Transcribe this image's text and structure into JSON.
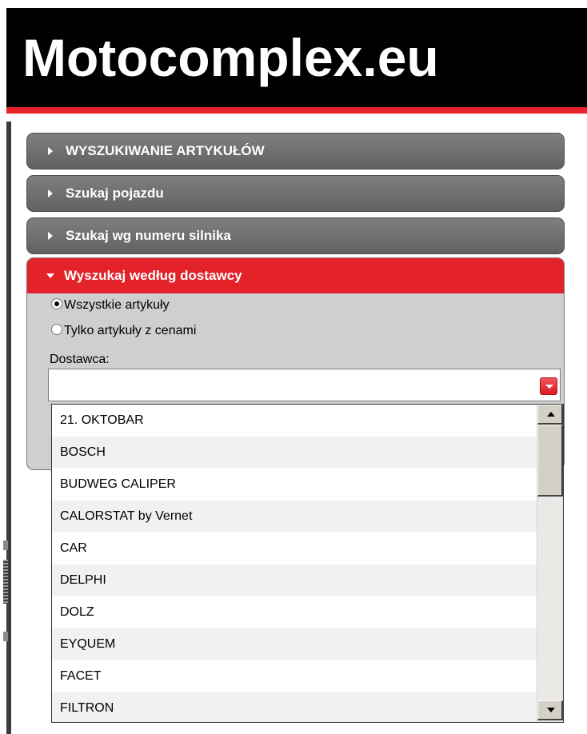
{
  "header": {
    "logo_text": "Motocomplex.eu"
  },
  "colors": {
    "brand_red": "#e3222a",
    "panel_gray": "#6e6e6e",
    "header_black": "#000000"
  },
  "accordion": {
    "items": [
      {
        "label": "WYSZUKIWANIE ARTYKUŁÓW",
        "expanded": false
      },
      {
        "label": "Szukaj pojazdu",
        "expanded": false
      },
      {
        "label": "Szukaj wg numeru silnika",
        "expanded": false
      },
      {
        "label": "Wyszukaj według dostawcy",
        "expanded": true
      }
    ]
  },
  "supplier_search": {
    "radio_all": "Wszystkie artykuły",
    "radio_priced": "Tylko artykuły z cenami",
    "selected_radio": "all",
    "supplier_label": "Dostawca:",
    "supplier_value": ""
  },
  "dropdown": {
    "options": [
      "21. OKTOBAR",
      "BOSCH",
      "BUDWEG CALIPER",
      "CALORSTAT by Vernet",
      "CAR",
      "DELPHI",
      "DOLZ",
      "EYQUEM",
      "FACET",
      "FILTRON"
    ]
  }
}
